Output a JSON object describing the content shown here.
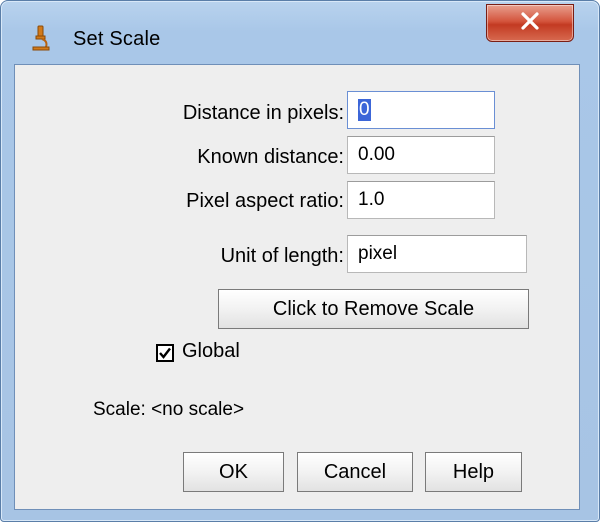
{
  "window": {
    "title": "Set Scale",
    "app_icon": "microscope-icon",
    "close_icon": "close-x-icon"
  },
  "form": {
    "distance_label": "Distance in pixels:",
    "distance_value": "0",
    "known_label": "Known distance:",
    "known_value": "0.00",
    "aspect_label": "Pixel aspect ratio:",
    "aspect_value": "1.0",
    "unit_label": "Unit of length:",
    "unit_value": "pixel"
  },
  "remove_scale_label": "Click to Remove Scale",
  "global_checkbox": {
    "label": "Global",
    "checked": true
  },
  "status_text": "Scale: <no scale>",
  "buttons": {
    "ok": "OK",
    "cancel": "Cancel",
    "help": "Help"
  },
  "colors": {
    "title_frame": "#a9c7e8",
    "close_button": "#c8442b",
    "dialog_body": "#eeeeee",
    "selection": "#3c66d8"
  }
}
